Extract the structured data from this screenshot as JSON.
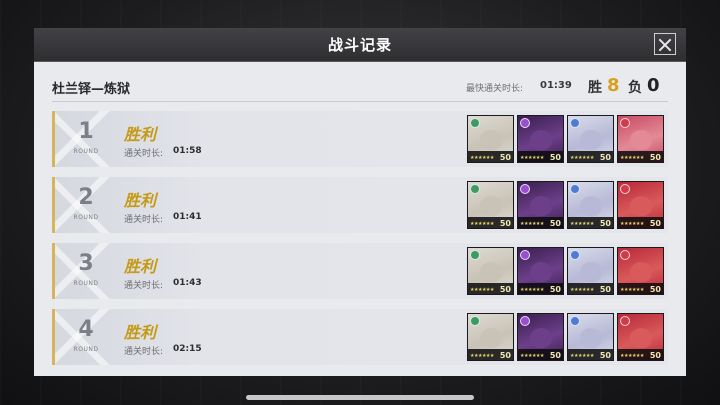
{
  "dialog": {
    "title": "战斗记录",
    "stage_name": "杜兰铎—炼狱",
    "fastest_label": "最快通关时长:",
    "fastest_time": "01:39",
    "win_label": "胜",
    "win_count": "8",
    "loss_label": "负",
    "loss_count": "0"
  },
  "rows": [
    {
      "round": "1",
      "round_label": "ROUND",
      "result": "胜利",
      "time_label": "通关时长:",
      "time": "01:58",
      "team": [
        {
          "level": "50",
          "stars": "★★★★★★",
          "art": "#dedbd2",
          "face": "#c9c2b6",
          "elem": "#3d9a63",
          "elem_icon": "wind-icon"
        },
        {
          "level": "50",
          "stars": "★★★★★★",
          "art": "#3a1f4f",
          "face": "#6d3f8a",
          "elem": "#9a4fd0",
          "elem_icon": "star-icon"
        },
        {
          "level": "50",
          "stars": "★★★★★★",
          "art": "#d9dbea",
          "face": "#b7b9d6",
          "elem": "#4f7cd2",
          "elem_icon": "gear-icon"
        },
        {
          "level": "50",
          "stars": "★★★★★★",
          "art": "#c94a62",
          "face": "#e38a96",
          "elem": "#d23a4a",
          "elem_icon": "cross-icon"
        }
      ]
    },
    {
      "round": "2",
      "round_label": "ROUND",
      "result": "胜利",
      "time_label": "通关时长:",
      "time": "01:41",
      "team": [
        {
          "level": "50",
          "stars": "★★★★★★",
          "art": "#dedbd2",
          "face": "#c9c2b6",
          "elem": "#3d9a63",
          "elem_icon": "wind-icon"
        },
        {
          "level": "50",
          "stars": "★★★★★★",
          "art": "#3a1f4f",
          "face": "#6d3f8a",
          "elem": "#9a4fd0",
          "elem_icon": "star-icon"
        },
        {
          "level": "50",
          "stars": "★★★★★★",
          "art": "#d9dbea",
          "face": "#b7b9d6",
          "elem": "#4f7cd2",
          "elem_icon": "gear-icon"
        },
        {
          "level": "50",
          "stars": "★★★★★★",
          "art": "#b8283a",
          "face": "#d95a5a",
          "elem": "#d23a4a",
          "elem_icon": "cross-icon"
        }
      ]
    },
    {
      "round": "3",
      "round_label": "ROUND",
      "result": "胜利",
      "time_label": "通关时长:",
      "time": "01:43",
      "team": [
        {
          "level": "50",
          "stars": "★★★★★★",
          "art": "#dedbd2",
          "face": "#c9c2b6",
          "elem": "#3d9a63",
          "elem_icon": "wind-icon"
        },
        {
          "level": "50",
          "stars": "★★★★★★",
          "art": "#3a1f4f",
          "face": "#6d3f8a",
          "elem": "#9a4fd0",
          "elem_icon": "star-icon"
        },
        {
          "level": "50",
          "stars": "★★★★★★",
          "art": "#d9dbea",
          "face": "#b7b9d6",
          "elem": "#4f7cd2",
          "elem_icon": "gear-icon"
        },
        {
          "level": "50",
          "stars": "★★★★★★",
          "art": "#b8283a",
          "face": "#d95a5a",
          "elem": "#d23a4a",
          "elem_icon": "cross-icon"
        }
      ]
    },
    {
      "round": "4",
      "round_label": "ROUND",
      "result": "胜利",
      "time_label": "通关时长:",
      "time": "02:15",
      "team": [
        {
          "level": "50",
          "stars": "★★★★★★",
          "art": "#dedbd2",
          "face": "#c9c2b6",
          "elem": "#3d9a63",
          "elem_icon": "wind-icon"
        },
        {
          "level": "50",
          "stars": "★★★★★★",
          "art": "#3a1f4f",
          "face": "#6d3f8a",
          "elem": "#9a4fd0",
          "elem_icon": "star-icon"
        },
        {
          "level": "50",
          "stars": "★★★★★★",
          "art": "#d9dbea",
          "face": "#b7b9d6",
          "elem": "#4f7cd2",
          "elem_icon": "gear-icon"
        },
        {
          "level": "50",
          "stars": "★★★★★★",
          "art": "#b8283a",
          "face": "#d95a5a",
          "elem": "#d23a4a",
          "elem_icon": "cross-icon"
        }
      ]
    }
  ],
  "colors": {
    "accent_gold": "#c49a16",
    "win_gold": "#d6a21e",
    "title_bar": "#2e2e31"
  }
}
